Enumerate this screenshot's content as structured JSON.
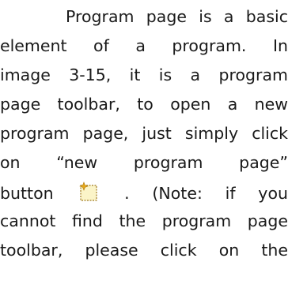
{
  "document": {
    "lines": [
      "Program page is a basic",
      "element of a program. In",
      "image 3-15, it is a program",
      "page toolbar, to open a new",
      "program page, just simply click",
      "on “new program page”",
      "button",
      ". (Note: if you",
      "cannot find the program page",
      "toolbar, please click on the"
    ],
    "inline_icon": "new-program-page-icon"
  },
  "colors": {
    "text": "#1a1a1a",
    "icon_page_fill": "#fbf4c8",
    "icon_page_border": "#a07a1e",
    "icon_star": "#e5a81a"
  }
}
